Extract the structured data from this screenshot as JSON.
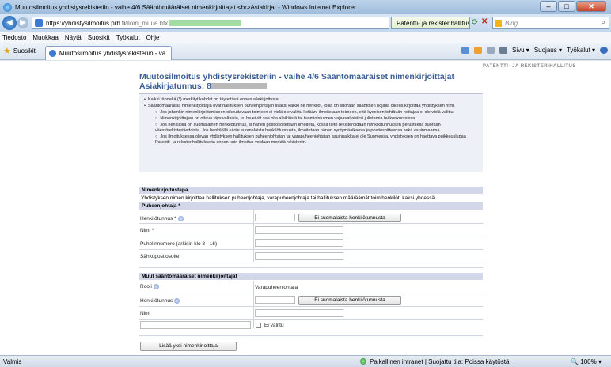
{
  "window": {
    "title": "Muutosilmoitus yhdistysrekisteriin - vaihe 4/6 Sääntömääräiset nimenkirjoittajat <br>Asiakirjat - Windows Internet Explorer",
    "min": "–",
    "max": "□",
    "close": "✕"
  },
  "nav": {
    "url_host": "https://yhdistysilmoitus.prh.fi",
    "url_path": "/ilom_muue.htx",
    "security_text": "Patentti- ja rekisterihallitus [FI]",
    "search_placeholder": "Bing"
  },
  "menu": [
    "Tiedosto",
    "Muokkaa",
    "Näytä",
    "Suosikit",
    "Työkalut",
    "Ohje"
  ],
  "favorites": {
    "label": "Suosikit",
    "tab": "Muutosilmoitus yhdistysrekisteriin - va...",
    "cmds": [
      "Sivu ▾",
      "Suojaus ▾",
      "Työkalut ▾"
    ]
  },
  "page": {
    "brand": "PATENTTI- JA REKISTERIHALLITUS",
    "title": "Muutosilmoitus yhdistysrekisteriin - vaihe 4/6 Sääntömääräiset nimenkirjoittajat",
    "subtitle": "Asiakirjatunnus: 8",
    "info": {
      "b1": "Kaikki tähdellä (*) merkityt kohdat on täytettävä ennen allekirjoitusta.",
      "b2": "Sääntömääräisiä nimenkirjoittajia ovat hallituksen puheenjohtajan lisäksi kaikki ne henkilöt, joilla on suoraan sääntöjen nojalla oikeus kirjoittaa yhdistyksen nimi.",
      "c1": "Jos johonkin nimenkirjoittamiseen oikeuttavaan toimeen ei vielä ole valittu ketään, ilmoitetaan toimeen, että kyseisen tehtävän hoitajaa ei ole vielä valittu.",
      "c2": "Nimenkirjoittajien on oltava täysivaltaisia, ts. he eivät saa olla alaikäisiä tai tuomioistuimen vajaavaltaisiksi julistamia tai konkurssissa.",
      "c3": "Jos henkilöllä on suomalainen henkilötunnus, si hänen postiosoitettaan ilmoiteta, koska tieto rekisteröidään henkilötunnuksen perusteella suoraan väestörekisteritiedoista. Jos henkilöllä ei ole suomalaista henkilötunnusta, ilmoitetaan hänen syntymäaikansa ja postiosoitteensa sekä asuinmaansa.",
      "c4": "Jos ilmoituksessa olevan yhdistyksen hallituksen puheenjohtajan tai varapuheenjohtajan asuinpaikka ei ole Suomessa, yhdistyksen on haettava poikkeuslupaa Patentti- ja rekisterihallitukselta ennen kuin ilmoitus voidaan merkitä rekisteriin."
    },
    "sec_nimenkirjoitustapa": "Nimenkirjoitustapa",
    "nimenkirjoitustapa_text": "Yhdistyksen nimen kirjoittaa hallituksen puheenjohtaja, varapuheenjohtaja tai hallituksen määräämät toimihenkilöt, kaksi yhdessä.",
    "sec_puheenjohtaja": "Puheenjohtaja *",
    "lbl_henkilotunnus_req": "Henkilötunnus *",
    "btn_ei_suomalaista": "Ei suomalaista henkilötunnusta",
    "lbl_nimi_req": "Nimi *",
    "lbl_puhelin": "Puhelinnumero (arkisin klo 8 - 16)",
    "lbl_sahkoposti": "Sähköpostiosoite",
    "sec_muut": "Muut sääntömääräiset nimenkirjoittajat",
    "lbl_rooli": "Rooli",
    "rooli_value": "Varapuheenjohtaja",
    "lbl_henkilotunnus": "Henkilötunnus",
    "btn_ei_suomalaista2": "Ei suomalaista henkilötunnusta",
    "lbl_nimi": "Nimi",
    "ei_valittu": "Ei valittu",
    "btn_lisaa": "Lisää yksi nimenkirjoittaja"
  },
  "status": {
    "left": "Valmis",
    "zone": "Paikallinen intranet | Suojattu tila: Poissa käytöstä",
    "zoom": "100%"
  }
}
